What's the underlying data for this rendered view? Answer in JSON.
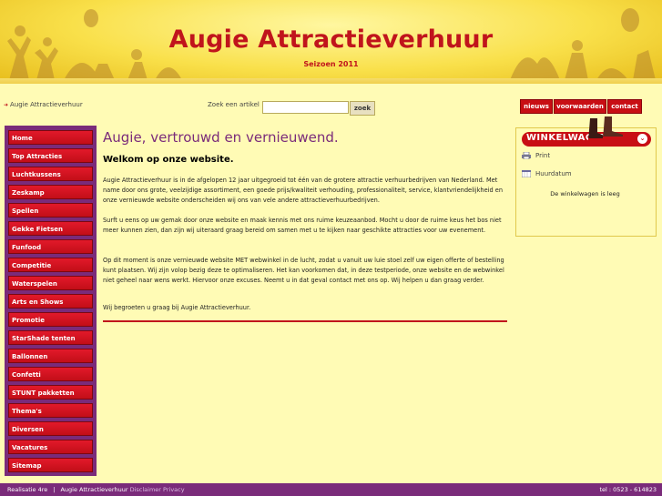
{
  "header": {
    "site_title": "Augie Attractieverhuur",
    "season": "Seizoen 2011"
  },
  "breadcrumb": {
    "label": "Augie Attractieverhuur"
  },
  "search": {
    "label": "Zoek een artikel",
    "placeholder": "",
    "value": "",
    "button_label": "zoek"
  },
  "top_links": [
    "nieuws",
    "voorwaarden",
    "contact"
  ],
  "nav": {
    "items": [
      "Home",
      "Top Attracties",
      "Luchtkussens",
      "Zeskamp",
      "Spellen",
      "Gekke Fietsen",
      "Funfood",
      "Competitie",
      "Waterspelen",
      "Arts en Shows",
      "Promotie",
      "StarShade tenten",
      "Ballonnen",
      "Confetti",
      "STUNT pakketten",
      "Thema's",
      "Diversen",
      "Vacatures",
      "Sitemap"
    ]
  },
  "main": {
    "title": "Augie, vertrouwd en vernieuwend.",
    "subtitle": "Welkom op onze website.",
    "paragraphs": [
      "Augie Attractieverhuur is in de afgelopen 12 jaar uitgegroeid tot één van de grotere attractie verhuurbedrijven van Nederland. Met name door ons grote, veelzijdige assortiment, een goede prijs/kwaliteit verhouding, professionaliteit, service, klantvriendelijkheid en onze vernieuwde website onderscheiden wij ons van vele andere attractieverhuurbedrijven.",
      "Surft u eens op uw gemak door onze website en maak kennis met ons ruime keuzeaanbod. Mocht u door de ruime keus het bos niet meer kunnen zien, dan zijn wij uiteraard graag bereid om samen met u te kijken naar geschikte attracties voor uw evenement.",
      "Op dit moment is onze vernieuwde website MET webwinkel in de lucht, zodat u vanuit uw luie stoel zelf uw eigen offerte of bestelling kunt plaatsen. Wij zijn volop bezig deze te optimaliseren. Het kan voorkomen dat, in deze testperiode, onze website en de webwinkel niet geheel naar wens werkt. Hiervoor onze excuses. Neemt u in dat geval contact met ons op. Wij helpen u dan graag verder.",
      "Wij begroeten u graag bij Augie Attractieverhuur."
    ]
  },
  "cart": {
    "title": "WINKELWAGEN",
    "print_label": "Print",
    "hire_date_label": "Huurdatum",
    "empty_text": "De winkelwagen is leeg"
  },
  "footer": {
    "credit": "Realisatie 4re",
    "site": "Augie Attractieverhuur",
    "disclaimer": "Disclaimer",
    "privacy": "Privacy",
    "phone": "tel : 0523 - 614823"
  },
  "colors": {
    "brand_red": "#c0141c",
    "purple": "#7a2b7a",
    "background": "#fffbb5"
  }
}
